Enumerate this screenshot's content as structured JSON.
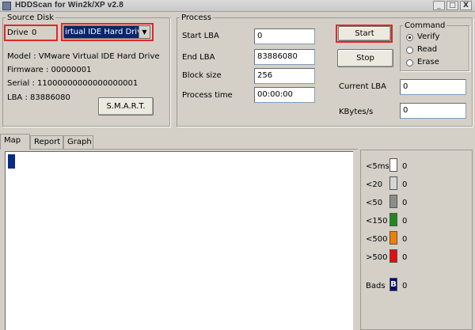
{
  "window": {
    "title": "HDDScan for Win2k/XP  v2.8",
    "min": "_",
    "max": "□",
    "close": "X"
  },
  "source_disk": {
    "legend": "Source Disk",
    "drive_label": "Drive",
    "drive_number": "0",
    "drive_select": "irtual IDE Hard Drive",
    "model": "Model : VMware Virtual IDE Hard Drive",
    "firmware": "Firmware : 00000001",
    "serial": "Serial : 11000000000000000001",
    "lba": "LBA :  83886080",
    "smart_button": "S.M.A.R.T."
  },
  "process": {
    "legend": "Process",
    "start_lba_label": "Start LBA",
    "start_lba": "0",
    "end_lba_label": "End LBA",
    "end_lba": "83886080",
    "block_size_label": "Block size",
    "block_size": "256",
    "process_time_label": "Process time",
    "process_time": "00:00:00",
    "start_button": "Start",
    "stop_button": "Stop",
    "current_lba_label": "Current LBA",
    "current_lba": "0",
    "kbytes_label": "KBytes/s",
    "kbytes": "0"
  },
  "command": {
    "legend": "Command",
    "options": [
      {
        "label": "Verify",
        "selected": true
      },
      {
        "label": "Read",
        "selected": false
      },
      {
        "label": "Erase",
        "selected": false
      }
    ]
  },
  "tabs": [
    {
      "label": "Map",
      "active": true
    },
    {
      "label": "Report",
      "active": false
    },
    {
      "label": "Graph",
      "active": false
    }
  ],
  "legend_items": [
    {
      "label": "<5ms",
      "count": "0",
      "color": "#ffffff"
    },
    {
      "label": "<20",
      "count": "0",
      "color": "#d6d6d6"
    },
    {
      "label": "<50",
      "count": "0",
      "color": "#8c8c8c"
    },
    {
      "label": "<150",
      "count": "0",
      "color": "#1e8a1e"
    },
    {
      "label": "<500",
      "count": "0",
      "color": "#f07f00"
    },
    {
      "label": ">500",
      "count": "0",
      "color": "#e01010"
    }
  ],
  "bads": {
    "label": "Bads",
    "glyph": "B",
    "count": "0",
    "color": "#0a0a6a"
  }
}
